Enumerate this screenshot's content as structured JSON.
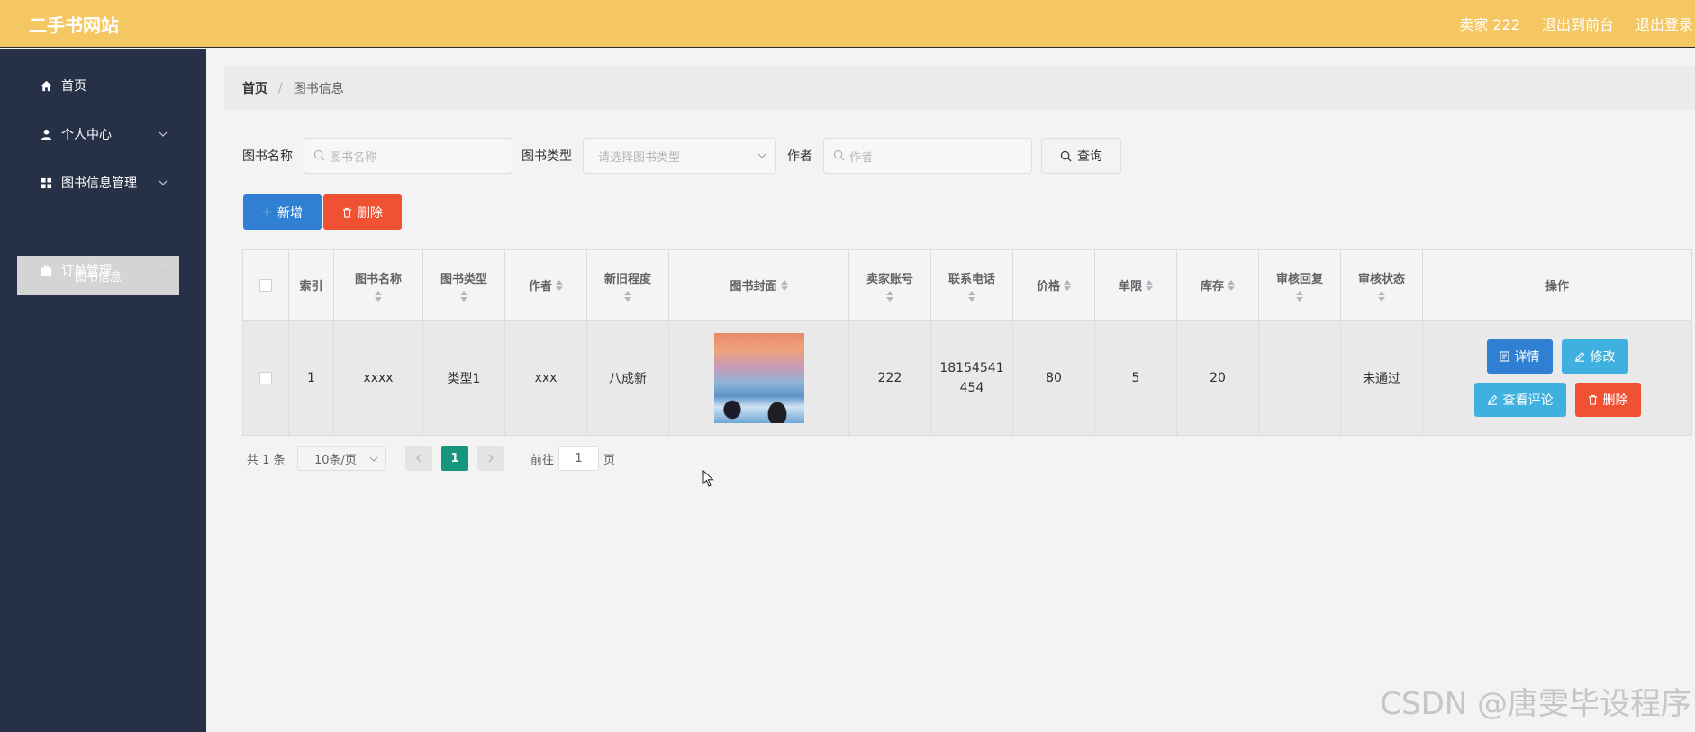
{
  "header": {
    "brand": "二手书网站",
    "user": "卖家 222",
    "back_to_front": "退出到前台",
    "logout": "退出登录"
  },
  "sidebar": {
    "items": [
      {
        "label": "首页",
        "icon": "home-icon"
      },
      {
        "label": "个人中心",
        "icon": "user-icon"
      },
      {
        "label": "图书信息管理",
        "icon": "grid-icon"
      },
      {
        "label": "订单管理",
        "icon": "briefcase-icon"
      }
    ],
    "submenu": {
      "label": "图书信息"
    }
  },
  "breadcrumb": {
    "home": "首页",
    "separator": "/",
    "current": "图书信息"
  },
  "search": {
    "name_label": "图书名称",
    "name_placeholder": "图书名称",
    "type_label": "图书类型",
    "type_placeholder": "请选择图书类型",
    "author_label": "作者",
    "author_placeholder": "作者",
    "query_button": "查询"
  },
  "actions": {
    "add": "新增",
    "delete": "删除"
  },
  "table": {
    "columns": [
      "索引",
      "图书名称",
      "图书类型",
      "作者",
      "新旧程度",
      "图书封面",
      "卖家账号",
      "联系电话",
      "价格",
      "单限",
      "库存",
      "审核回复",
      "审核状态",
      "操作"
    ],
    "rows": [
      {
        "index": "1",
        "name": "xxxx",
        "type": "类型1",
        "author": "xxx",
        "condition": "八成新",
        "seller": "222",
        "phone_line1": "18154541",
        "phone_line2": "454",
        "price": "80",
        "limit": "5",
        "stock": "20",
        "review_reply": "",
        "review_status": "未通过",
        "ops": {
          "detail": "详情",
          "edit": "修改",
          "comments": "查看评论",
          "delete": "删除"
        }
      }
    ]
  },
  "pagination": {
    "total": "共 1 条",
    "page_size": "10条/页",
    "current_page": "1",
    "goto_label": "前往",
    "goto_value": "1",
    "page_unit": "页"
  },
  "watermark": "CSDN @唐雯毕设程序",
  "colors": {
    "topbar": "#f5c762",
    "sidebar": "#263148",
    "primary": "#2f7fd2",
    "info": "#3fb1e0",
    "danger": "#f05133",
    "active_page": "#17967f"
  }
}
